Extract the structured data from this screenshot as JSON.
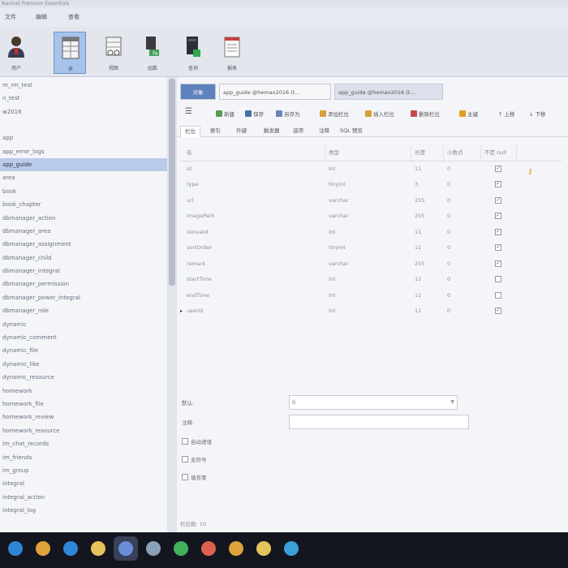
{
  "window": {
    "title": "Navicat Premium Essentials"
  },
  "menu": [
    "文件",
    "编辑",
    "查看"
  ],
  "ribbon": {
    "buttons": [
      {
        "label": "用户",
        "icon": "user-icon"
      },
      {
        "label": "表",
        "icon": "table-icon",
        "active": true
      },
      {
        "label": "视图",
        "icon": "view-icon"
      },
      {
        "label": "函数",
        "icon": "function-icon"
      },
      {
        "label": "查询",
        "icon": "query-icon"
      },
      {
        "label": "报表",
        "icon": "report-icon"
      }
    ]
  },
  "tree": {
    "top_items": [
      "m_rm_test",
      "n_test",
      "w2016"
    ],
    "items": [
      "app",
      "app_error_logs",
      "app_guide",
      "area",
      "book",
      "book_chapter",
      "dbmanager_action",
      "dbmanager_area",
      "dbmanager_assignment",
      "dbmanager_child",
      "dbmanager_integral",
      "dbmanager_permission",
      "dbmanager_power_integral",
      "dbmanager_role",
      "dynamic",
      "dynamic_comment",
      "dynamic_file",
      "dynamic_like",
      "dynamic_resource",
      "homework",
      "homework_file",
      "homework_review",
      "homework_resource",
      "im_chat_records",
      "im_friends",
      "im_group",
      "integral",
      "integral_action",
      "integral_log"
    ],
    "selected": "app_guide"
  },
  "tabs": {
    "objects": "对象",
    "tab1": "app_guide @hemao2016 (t...",
    "tab2": "app_guide @hemao2016 (t..."
  },
  "toolbar": {
    "save": "保存",
    "save_as": "另存为",
    "add_field": "添加栏位",
    "insert_field": "插入栏位",
    "delete_field": "删除栏位",
    "primary_key": "主键",
    "move_up": "上移",
    "move_down": "下移"
  },
  "subtabs": [
    "栏位",
    "索引",
    "外键",
    "触发器",
    "选项",
    "注释",
    "SQL 预览"
  ],
  "grid": {
    "headers": {
      "name": "名",
      "type": "类型",
      "length": "长度",
      "decimal": "小数点",
      "not_null": "不是 null",
      "key": ""
    },
    "rows": [
      {
        "name": "id",
        "type": "int",
        "length": "11",
        "decimal": "0",
        "not_null": true,
        "key": true
      },
      {
        "name": "type",
        "type": "tinyint",
        "length": "3",
        "decimal": "0",
        "not_null": true,
        "key": false
      },
      {
        "name": "url",
        "type": "varchar",
        "length": "255",
        "decimal": "0",
        "not_null": true,
        "key": false
      },
      {
        "name": "imagePath",
        "type": "varchar",
        "length": "255",
        "decimal": "0",
        "not_null": true,
        "key": false
      },
      {
        "name": "isInvalid",
        "type": "int",
        "length": "11",
        "decimal": "0",
        "not_null": true,
        "key": false
      },
      {
        "name": "sortOrder",
        "type": "tinyint",
        "length": "11",
        "decimal": "0",
        "not_null": true,
        "key": false
      },
      {
        "name": "remark",
        "type": "varchar",
        "length": "255",
        "decimal": "0",
        "not_null": true,
        "key": false
      },
      {
        "name": "startTime",
        "type": "int",
        "length": "11",
        "decimal": "0",
        "not_null": false,
        "key": false
      },
      {
        "name": "endTime",
        "type": "int",
        "length": "11",
        "decimal": "0",
        "not_null": false,
        "key": false
      },
      {
        "name": "userId",
        "type": "int",
        "length": "11",
        "decimal": "0",
        "not_null": true,
        "key": false,
        "current": true
      }
    ]
  },
  "properties": {
    "default_label": "默认:",
    "default_value": "0",
    "comment_label": "注释:",
    "comment_value": "",
    "auto_increment": "自动递增",
    "unsigned": "无符号",
    "zerofill": "填充零"
  },
  "status": {
    "field_count": "栏位数: 10"
  },
  "taskbar": {
    "apps": [
      {
        "icon": "windows-icon",
        "color": "#2f86d6"
      },
      {
        "icon": "chrome-icon",
        "color": "#e0a33a"
      },
      {
        "icon": "ie-icon",
        "color": "#2f86d6"
      },
      {
        "icon": "folder-icon",
        "color": "#e6c35a"
      },
      {
        "icon": "navicat-icon",
        "color": "#6a8fd8",
        "active": true
      },
      {
        "icon": "photos-icon",
        "color": "#8aa0b8"
      },
      {
        "icon": "green-app-icon",
        "color": "#3fb25e"
      },
      {
        "icon": "red-app-icon",
        "color": "#e06050"
      },
      {
        "icon": "chrome2-icon",
        "color": "#e0a33a"
      },
      {
        "icon": "yellow-app-icon",
        "color": "#e6c35a"
      },
      {
        "icon": "bird-app-icon",
        "color": "#3aa0d8"
      }
    ]
  }
}
